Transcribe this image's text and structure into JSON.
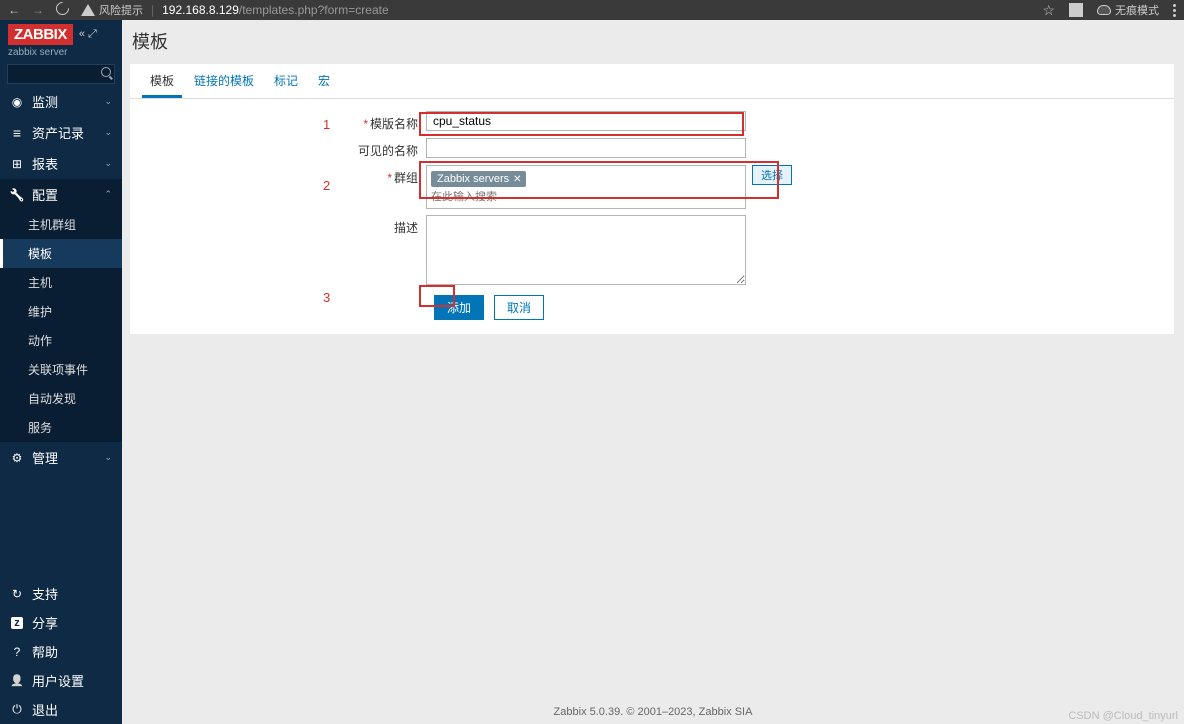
{
  "browser": {
    "warn_label": "风险提示",
    "url_domain": "192.168.8.129",
    "url_path": "/templates.php?form=create",
    "incognito_label": "无痕模式"
  },
  "sidebar": {
    "logo": "ZABBIX",
    "server": "zabbix server",
    "menu": {
      "monitoring": "监测",
      "inventory": "资产记录",
      "reports": "报表",
      "config": "配置",
      "admin": "管理"
    },
    "config_sub": {
      "hostgroups": "主机群组",
      "templates": "模板",
      "hosts": "主机",
      "maintenance": "维护",
      "actions": "动作",
      "correlation": "关联项事件",
      "discovery": "自动发现",
      "services": "服务"
    },
    "footer": {
      "support": "支持",
      "share": "分享",
      "help": "帮助",
      "user_settings": "用户设置",
      "logout": "退出"
    }
  },
  "page": {
    "title": "模板",
    "tabs": {
      "template": "模板",
      "linked": "链接的模板",
      "tags": "标记",
      "macros": "宏"
    },
    "form": {
      "name_label": "模版名称",
      "name_value": "cpu_status",
      "visible_name_label": "可见的名称",
      "groups_label": "群组",
      "group_tag": "Zabbix servers",
      "group_placeholder": "在此输入搜索",
      "select_btn": "选择",
      "desc_label": "描述",
      "add_btn": "添加",
      "cancel_btn": "取消"
    },
    "annotations": {
      "n1": "1",
      "n2": "2",
      "n3": "3"
    },
    "footer": "Zabbix 5.0.39. © 2001–2023, Zabbix SIA",
    "watermark": "CSDN @Cloud_tinyurl"
  }
}
